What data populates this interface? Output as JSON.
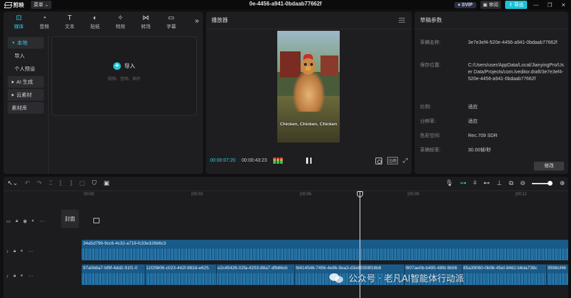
{
  "titlebar": {
    "app_name": "剪映",
    "menu_label": "菜单",
    "project_title": "0e-4456-a941-0bdaab77662f",
    "svip_label": "SVIP",
    "review_label": "审阅",
    "export_label": "导出",
    "window_buttons": [
      "—",
      "❐",
      "✕"
    ]
  },
  "tool_tabs": [
    {
      "label": "媒体",
      "icon": "media-icon"
    },
    {
      "label": "音频",
      "icon": "audio-icon"
    },
    {
      "label": "文本",
      "icon": "text-icon"
    },
    {
      "label": "贴纸",
      "icon": "sticker-icon"
    },
    {
      "label": "特效",
      "icon": "effects-icon"
    },
    {
      "label": "转场",
      "icon": "transition-icon"
    },
    {
      "label": "字幕",
      "icon": "subtitle-icon"
    }
  ],
  "media_nav": {
    "local": "本地",
    "import": "导入",
    "personal_presets": "个人预设",
    "ai_generate": "AI 生成",
    "cloud_material": "云素材",
    "material_library": "素材库"
  },
  "import_box": {
    "button_label": "导入",
    "hint": "视频、音频、图片"
  },
  "player": {
    "title": "播放器",
    "caption": "Chicken, Chicken, Chicken",
    "current_time": "00:00:07:20",
    "total_time": "00:00:43:23",
    "ratio_label": "比例"
  },
  "draft": {
    "title": "草稿参数",
    "rows": [
      {
        "key": "草稿名称:",
        "value": "3e7e3ef4-520e-4456-a941-0bdaab77662f"
      },
      {
        "key": "保存位置:",
        "value": "C:/Users/user/AppData/Local/JianyingPro/User Data/Projects/com.lveditor.draft/3e7e3ef4-520e-4456-a941-0bdaab77662f"
      },
      {
        "key": "比例:",
        "value": "适应"
      },
      {
        "key": "分辨率:",
        "value": "适应"
      },
      {
        "key": "色彩空间:",
        "value": "Rec.709 SDR"
      },
      {
        "key": "草稿帧率:",
        "value": "30.00帧/秒"
      }
    ],
    "modify_label": "修改"
  },
  "timeline": {
    "ruler": [
      "00:00",
      "|00:03",
      "|00:06",
      "|00:09",
      "|00:12"
    ],
    "cover_label": "封面",
    "audio_track_1_clip": "34a5d799-9cc6-4c32-a719-fc33e326b6c3",
    "audio_track_2_clips": [
      "97a0b6a7-bf9f-4dd2-91f1-0",
      "11f29806-c023-442f-882d-e625.",
      "e2c45426-02fa-4203-88a7-dfb66cb",
      "fd414548-7456-4e9b-9ea3-d3e80308f16b8",
      "f807ae0b-b495-48fd-9b56",
      "85a39060-0b08-45ef-8462-b6da738c",
      "9598cf46"
    ]
  },
  "watermark": {
    "text": "公众号 · 老凡AI智能体行动派"
  }
}
